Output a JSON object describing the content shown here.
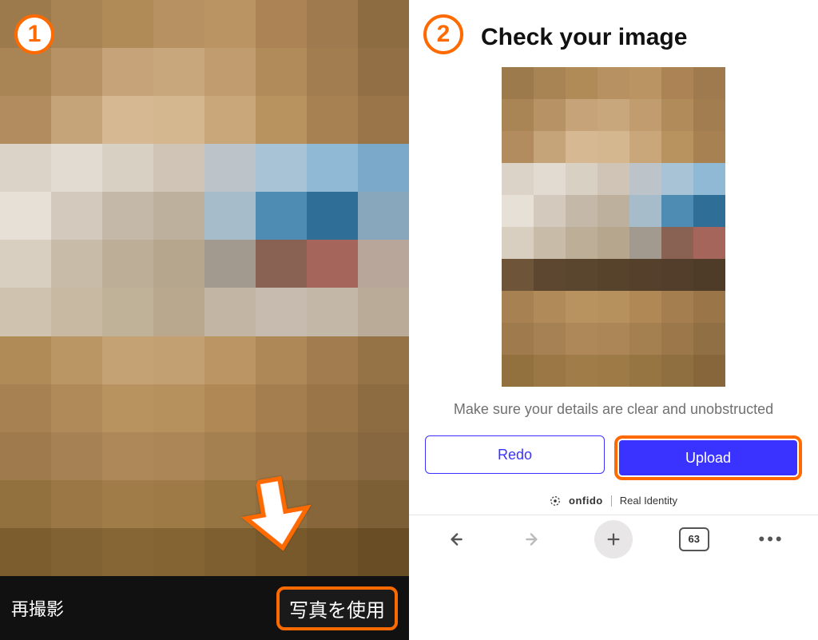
{
  "steps": {
    "one": "1",
    "two": "2"
  },
  "left": {
    "retake_label": "再撮影",
    "use_photo_label": "写真を使用"
  },
  "right": {
    "title": "Check your image",
    "instructions": "Make sure your details are clear and unobstructed",
    "redo_label": "Redo",
    "upload_label": "Upload",
    "brand_name": "onfido",
    "brand_tagline": "Real Identity",
    "tab_count": "63"
  },
  "colors": {
    "highlight": "#ff6a00",
    "primary": "#3a32ff"
  }
}
